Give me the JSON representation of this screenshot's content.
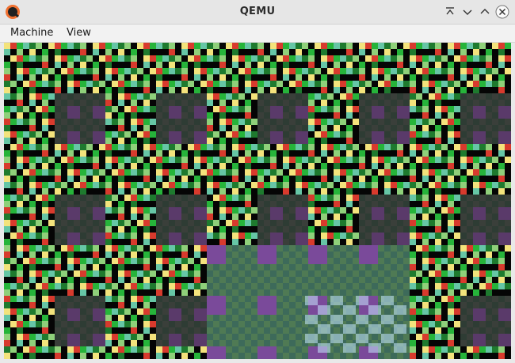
{
  "window": {
    "title": "QEMU"
  },
  "menubar": {
    "items": [
      {
        "label": "Machine"
      },
      {
        "label": "View"
      }
    ]
  },
  "titlebar_buttons": [
    {
      "icon": "minimize-to-top-icon"
    },
    {
      "icon": "chevron-down-icon"
    },
    {
      "icon": "chevron-up-icon"
    },
    {
      "icon": "close-icon"
    }
  ],
  "screen": {
    "description_icon": "guest-display",
    "palette": {
      "black": "#050505",
      "yellow": "#f3e37c",
      "red": "#d83a2d",
      "green": "#26b43a",
      "teal": "#66c6a6",
      "dim": "#3c4a3c",
      "purple": "#3a2a5a",
      "bright": "#c6e8ff"
    }
  }
}
